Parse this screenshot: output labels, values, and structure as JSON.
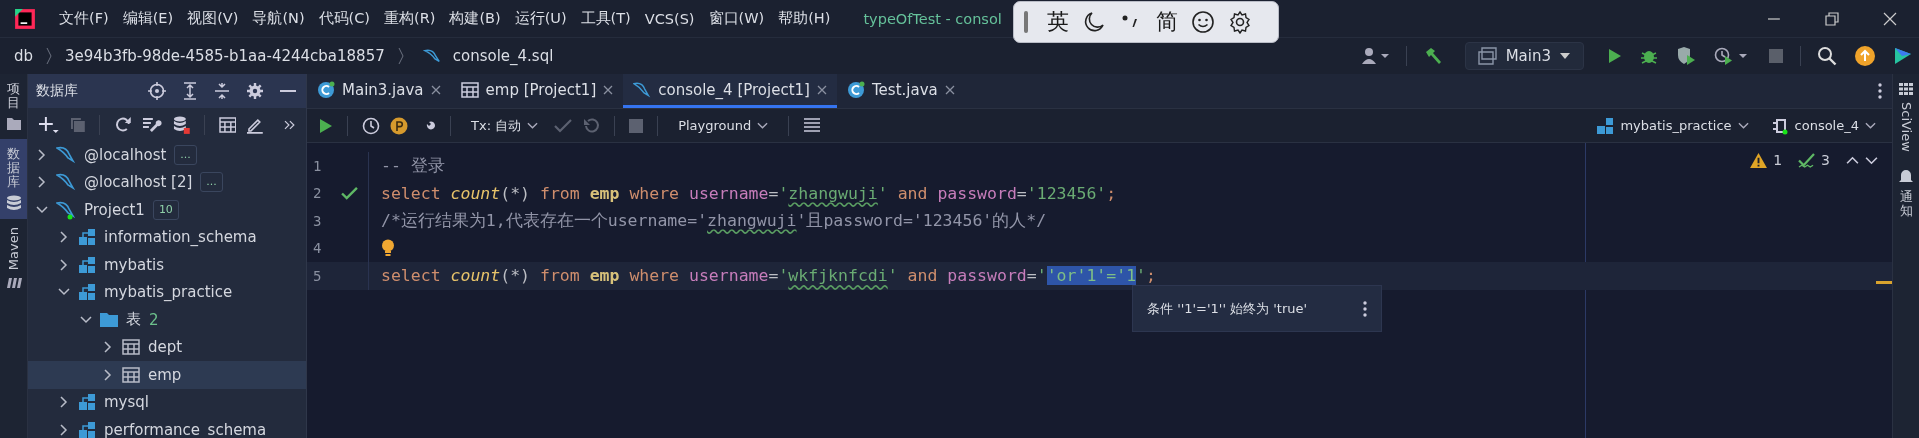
{
  "menu": [
    "文件(F)",
    "编辑(E)",
    "视图(V)",
    "导航(N)",
    "代码(C)",
    "重构(R)",
    "构建(B)",
    "运行(U)",
    "工具(T)",
    "VCS(S)",
    "窗口(W)",
    "帮助(H)"
  ],
  "window": {
    "title": "typeOfTest - consol"
  },
  "ime": {
    "mode": "英",
    "script": "简"
  },
  "run_config": "Main3",
  "breadcrumb": [
    "db",
    "3e94b3fb-98de-4585-b1aa-4244cba18857",
    "console_4.sql"
  ],
  "left_strip": [
    {
      "label": "项目",
      "kind": "cjk",
      "selected": false
    },
    {
      "label": "数据库",
      "kind": "cjk",
      "selected": true
    },
    {
      "label": "Maven",
      "kind": "latin",
      "selected": false
    }
  ],
  "db_panel": {
    "title": "数据库"
  },
  "tree": [
    {
      "label": "@localhost",
      "kind": "connection",
      "badge": "...",
      "expanded": false,
      "connected": false,
      "selected": false
    },
    {
      "label": "@localhost [2]",
      "kind": "connection",
      "badge": "...",
      "expanded": false,
      "connected": false,
      "selected": false
    },
    {
      "label": "Project1",
      "kind": "connection",
      "badge": "10",
      "expanded": true,
      "connected": true,
      "selected": false,
      "children": [
        {
          "label": "information_schema",
          "kind": "schema",
          "expanded": false,
          "selected": false
        },
        {
          "label": "mybatis",
          "kind": "schema",
          "expanded": false,
          "selected": false
        },
        {
          "label": "mybatis_practice",
          "kind": "schema",
          "expanded": true,
          "selected": false,
          "children": [
            {
              "label": "表",
              "kind": "folder",
              "count": "2",
              "expanded": true,
              "selected": false,
              "children": [
                {
                  "label": "dept",
                  "kind": "table",
                  "expanded": false,
                  "selected": false
                },
                {
                  "label": "emp",
                  "kind": "table",
                  "expanded": false,
                  "selected": true
                }
              ]
            }
          ]
        },
        {
          "label": "mysql",
          "kind": "schema",
          "expanded": false,
          "selected": false
        },
        {
          "label": "performance_schema",
          "kind": "schema",
          "expanded": false,
          "selected": false
        }
      ]
    }
  ],
  "tabs": [
    {
      "label": "Main3.java",
      "kind": "java",
      "selected": false
    },
    {
      "label": "emp [Project1]",
      "kind": "table",
      "selected": false
    },
    {
      "label": "console_4 [Project1]",
      "kind": "sql",
      "selected": true
    },
    {
      "label": "Test.java",
      "kind": "java",
      "selected": false
    }
  ],
  "editor_toolbar": {
    "transaction": "Tx: 自动",
    "mode": "Playground",
    "schema": "mybatis_practice",
    "session": "console_4"
  },
  "inspections": {
    "warnings": "1",
    "typos": "3"
  },
  "code": [
    {
      "number": "1",
      "kind": "plain",
      "current": false,
      "tokens": [
        {
          "text": "-- 登录",
          "kind": "comment"
        }
      ]
    },
    {
      "number": "2",
      "kind": "check",
      "current": false,
      "tokens": [
        {
          "text": "select ",
          "kind": "keyword"
        },
        {
          "text": "count",
          "kind": "function"
        },
        {
          "text": "(*) ",
          "kind": "punct"
        },
        {
          "text": "from ",
          "kind": "keyword"
        },
        {
          "text": "emp",
          "kind": "table"
        },
        {
          "text": " where ",
          "kind": "keyword"
        },
        {
          "text": "username",
          "kind": "column"
        },
        {
          "text": "=",
          "kind": "punct"
        },
        {
          "text": "'",
          "kind": "string"
        },
        {
          "text": "zhangwuji",
          "kind": "string-typo"
        },
        {
          "text": "'",
          "kind": "string"
        },
        {
          "text": " and ",
          "kind": "keyword"
        },
        {
          "text": "password",
          "kind": "column"
        },
        {
          "text": "=",
          "kind": "punct"
        },
        {
          "text": "'123456'",
          "kind": "string"
        },
        {
          "text": ";",
          "kind": "keyword"
        }
      ]
    },
    {
      "number": "3",
      "kind": "plain",
      "current": false,
      "tokens": [
        {
          "text": "/*运行结果为1,代表存在一个username='",
          "kind": "comment"
        },
        {
          "text": "zhangwuji",
          "kind": "comment-typo"
        },
        {
          "text": "'且password='123456'的人*/",
          "kind": "comment"
        }
      ]
    },
    {
      "number": "4",
      "kind": "bulb",
      "current": false
    },
    {
      "number": "5",
      "kind": "plain",
      "current": true,
      "tokens": [
        {
          "text": "select ",
          "kind": "keyword"
        },
        {
          "text": "count",
          "kind": "function"
        },
        {
          "text": "(*) ",
          "kind": "punct"
        },
        {
          "text": "from ",
          "kind": "keyword"
        },
        {
          "text": "emp",
          "kind": "table"
        },
        {
          "text": " where ",
          "kind": "keyword"
        },
        {
          "text": "username",
          "kind": "column"
        },
        {
          "text": "=",
          "kind": "punct"
        },
        {
          "text": "'",
          "kind": "string"
        },
        {
          "text": "wkfjknfcdi",
          "kind": "string-typo"
        },
        {
          "text": "'",
          "kind": "string"
        },
        {
          "text": " and ",
          "kind": "keyword"
        },
        {
          "text": "password",
          "kind": "column"
        },
        {
          "text": "=",
          "kind": "punct"
        },
        {
          "text": "'",
          "kind": "string"
        },
        {
          "text": "'or'1'='1",
          "kind": "selection"
        },
        {
          "text": "'",
          "kind": "string"
        },
        {
          "text": ";",
          "kind": "keyword"
        }
      ]
    }
  ],
  "tooltip": {
    "text": "条件 ''1'='1'' 始终为 'true'"
  },
  "right_strip": [
    {
      "label": "SciView",
      "kind": "latin"
    },
    {
      "label": "通知",
      "kind": "cjk"
    }
  ]
}
